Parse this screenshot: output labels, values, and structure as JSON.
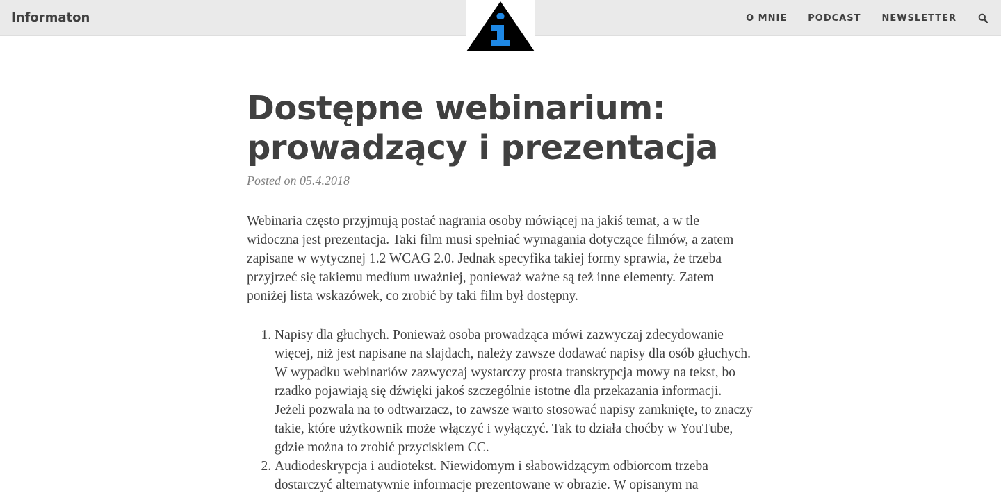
{
  "site": {
    "brand": "Informaton",
    "nav": [
      {
        "label": "O MNIE"
      },
      {
        "label": "PODCAST"
      },
      {
        "label": "NEWSLETTER"
      }
    ],
    "logo_colors": {
      "triangle": "#000000",
      "letter": "#1e88e5"
    }
  },
  "post": {
    "title": "Dostępne webinarium: prowadzący i prezentacja",
    "meta": "Posted on 05.4.2018",
    "intro": "Webinaria często przyjmują postać nagrania osoby mówiącej na jakiś temat, a w tle widoczna jest prezentacja. Taki film musi spełniać wymagania dotyczące filmów, a zatem zapisane w wytycznej 1.2 WCAG 2.0. Jednak specyfika takiej formy sprawia, że trzeba przyjrzeć się takiemu medium uważniej, ponieważ ważne są też inne elementy. Zatem poniżej lista wskazówek, co zrobić by taki film był dostępny.",
    "list": [
      "Napisy dla głuchych. Ponieważ osoba prowadząca mówi zazwyczaj zdecydowanie więcej, niż jest napisane na slajdach, należy zawsze dodawać napisy dla osób głuchych. W wypadku webinariów zazwyczaj wystarczy prosta transkrypcja mowy na tekst, bo rzadko pojawiają się dźwięki jakoś szczególnie istotne dla przekazania informacji. Jeżeli pozwala na to odtwarzacz, to zawsze warto stosować napisy zamknięte, to znaczy takie, które użytkownik może włączyć i wyłączyć. Tak to działa choćby w YouTube, gdzie można to zrobić przyciskiem CC.",
      "Audiodeskrypcja i audiotekst. Niewidomym i słabowidzącym odbiorcom trzeba dostarczyć alternatywnie informacje prezentowane w obrazie. W opisanym na"
    ]
  }
}
